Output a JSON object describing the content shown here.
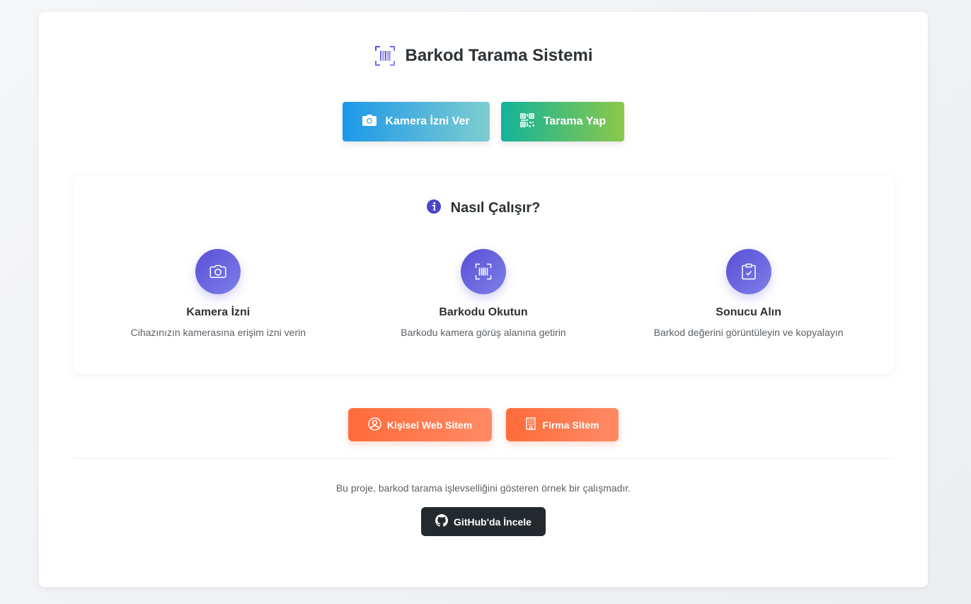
{
  "header": {
    "title": "Barkod Tarama Sistemi",
    "logo_icon": "barcode-scan-icon"
  },
  "actions": {
    "camera_label": "Kamera İzni Ver",
    "camera_icon": "camera-icon",
    "scan_label": "Tarama Yap",
    "scan_icon": "qr-code-icon"
  },
  "how_it_works": {
    "title": "Nasıl Çalışır?",
    "title_icon": "info-icon",
    "steps": [
      {
        "icon": "camera-icon",
        "title": "Kamera İzni",
        "description": "Cihazınızın kamerasına erişim izni verin"
      },
      {
        "icon": "barcode-scan-icon",
        "title": "Barkodu Okutun",
        "description": "Barkodu kamera görüş alanına getirin"
      },
      {
        "icon": "clipboard-check-icon",
        "title": "Sonucu Alın",
        "description": "Barkod değerini görüntüleyin ve kopyalayın"
      }
    ]
  },
  "links": {
    "personal_label": "Kişisel Web Sitem",
    "personal_icon": "user-circle-icon",
    "company_label": "Firma Sitem",
    "company_icon": "building-icon"
  },
  "footer": {
    "text": "Bu proje, barkod tarama işlevselliğini gösteren örnek bir çalışmadır.",
    "github_label": "GitHub'da İncele",
    "github_icon": "github-icon"
  },
  "colors": {
    "accent": "#5a4fd6",
    "camera_button": "#1d98e8",
    "scan_button": "#13b39a",
    "link_button": "#fe6b3a",
    "github_button": "#24292e"
  }
}
